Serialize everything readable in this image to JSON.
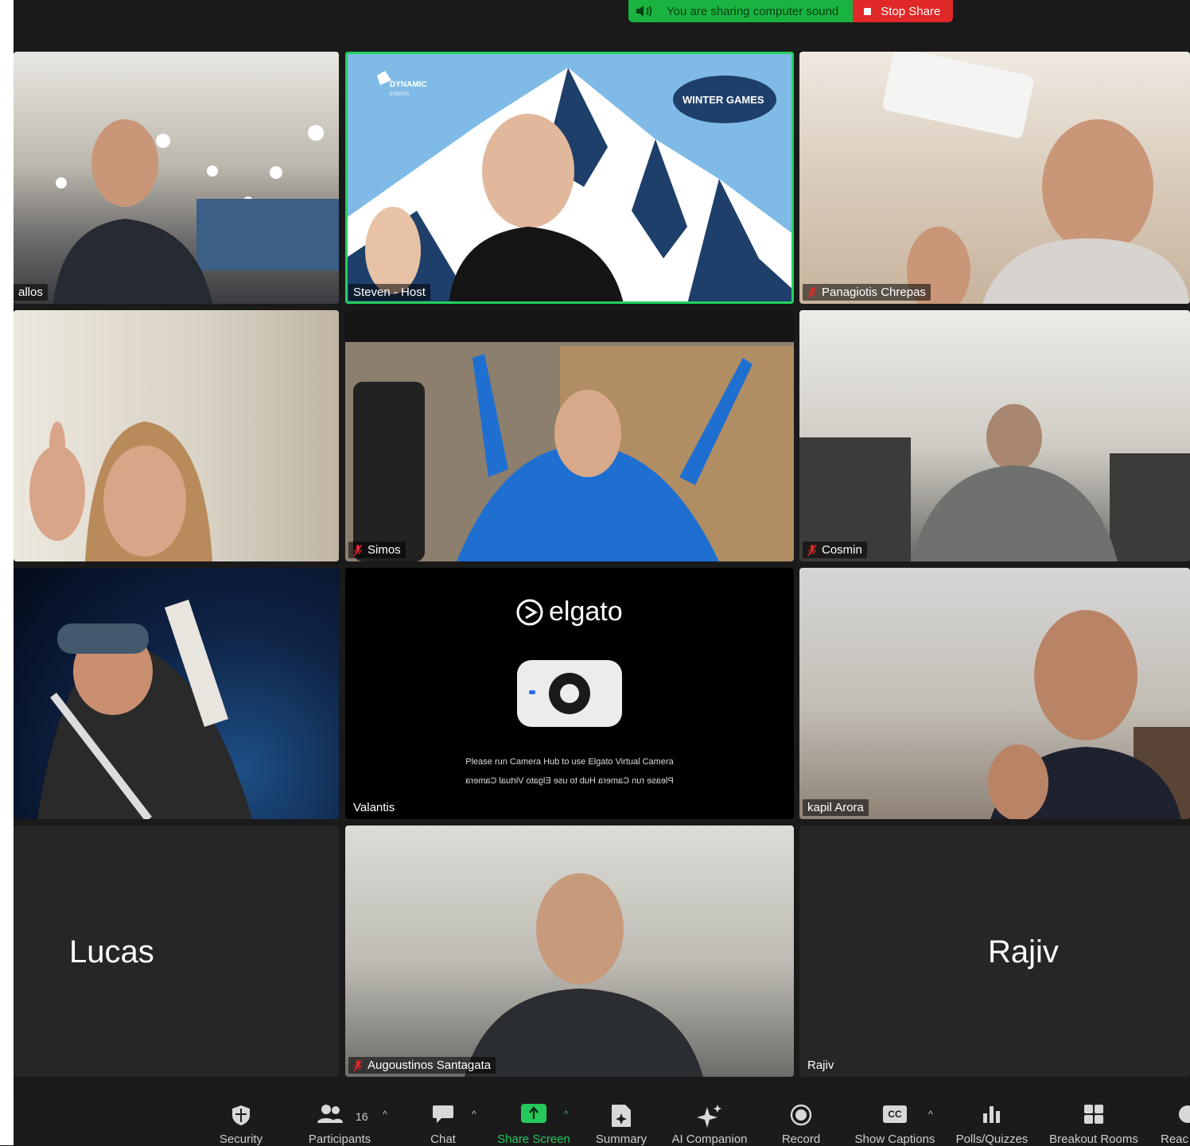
{
  "banner": {
    "sharing_text": "You are sharing computer sound",
    "stop_label": "Stop Share"
  },
  "tiles": {
    "t1": {
      "name": "allos"
    },
    "t2": {
      "name": "Steven - Host",
      "logo_text": "DYNAMIC",
      "logo_sub": "EVENTS",
      "badge_text": "WINTER GAMES"
    },
    "t3": {
      "name": "Panagiotis Chrepas"
    },
    "t4": {
      "name": ""
    },
    "t5": {
      "name": "Simos"
    },
    "t6": {
      "name": "Cosmin"
    },
    "t7": {
      "name": ""
    },
    "t8": {
      "name": "Valantis",
      "brand": "elgato",
      "msg": "Please run Camera Hub to use Elgato Virtual Camera",
      "msg_mirrored": "Please run Camera Hub to use Elgato Virtual Camera"
    },
    "t9": {
      "name": "kapil Arora"
    },
    "t10": {
      "big_name": "Lucas"
    },
    "t11": {
      "name": "Augoustinos Santagata"
    },
    "t12": {
      "big_name": "Rajiv",
      "name": "Rajiv"
    }
  },
  "toolbar": {
    "security": "Security",
    "participants": "Participants",
    "participants_count": "16",
    "chat": "Chat",
    "share_screen": "Share Screen",
    "summary": "Summary",
    "ai_companion": "AI Companion",
    "record": "Record",
    "show_captions": "Show Captions",
    "cc": "CC",
    "polls": "Polls/Quizzes",
    "breakout": "Breakout Rooms",
    "reactions": "Reac"
  },
  "colors": {
    "active_border": "#23d160",
    "share_green": "#19b33f",
    "stop_red": "#e02828"
  }
}
